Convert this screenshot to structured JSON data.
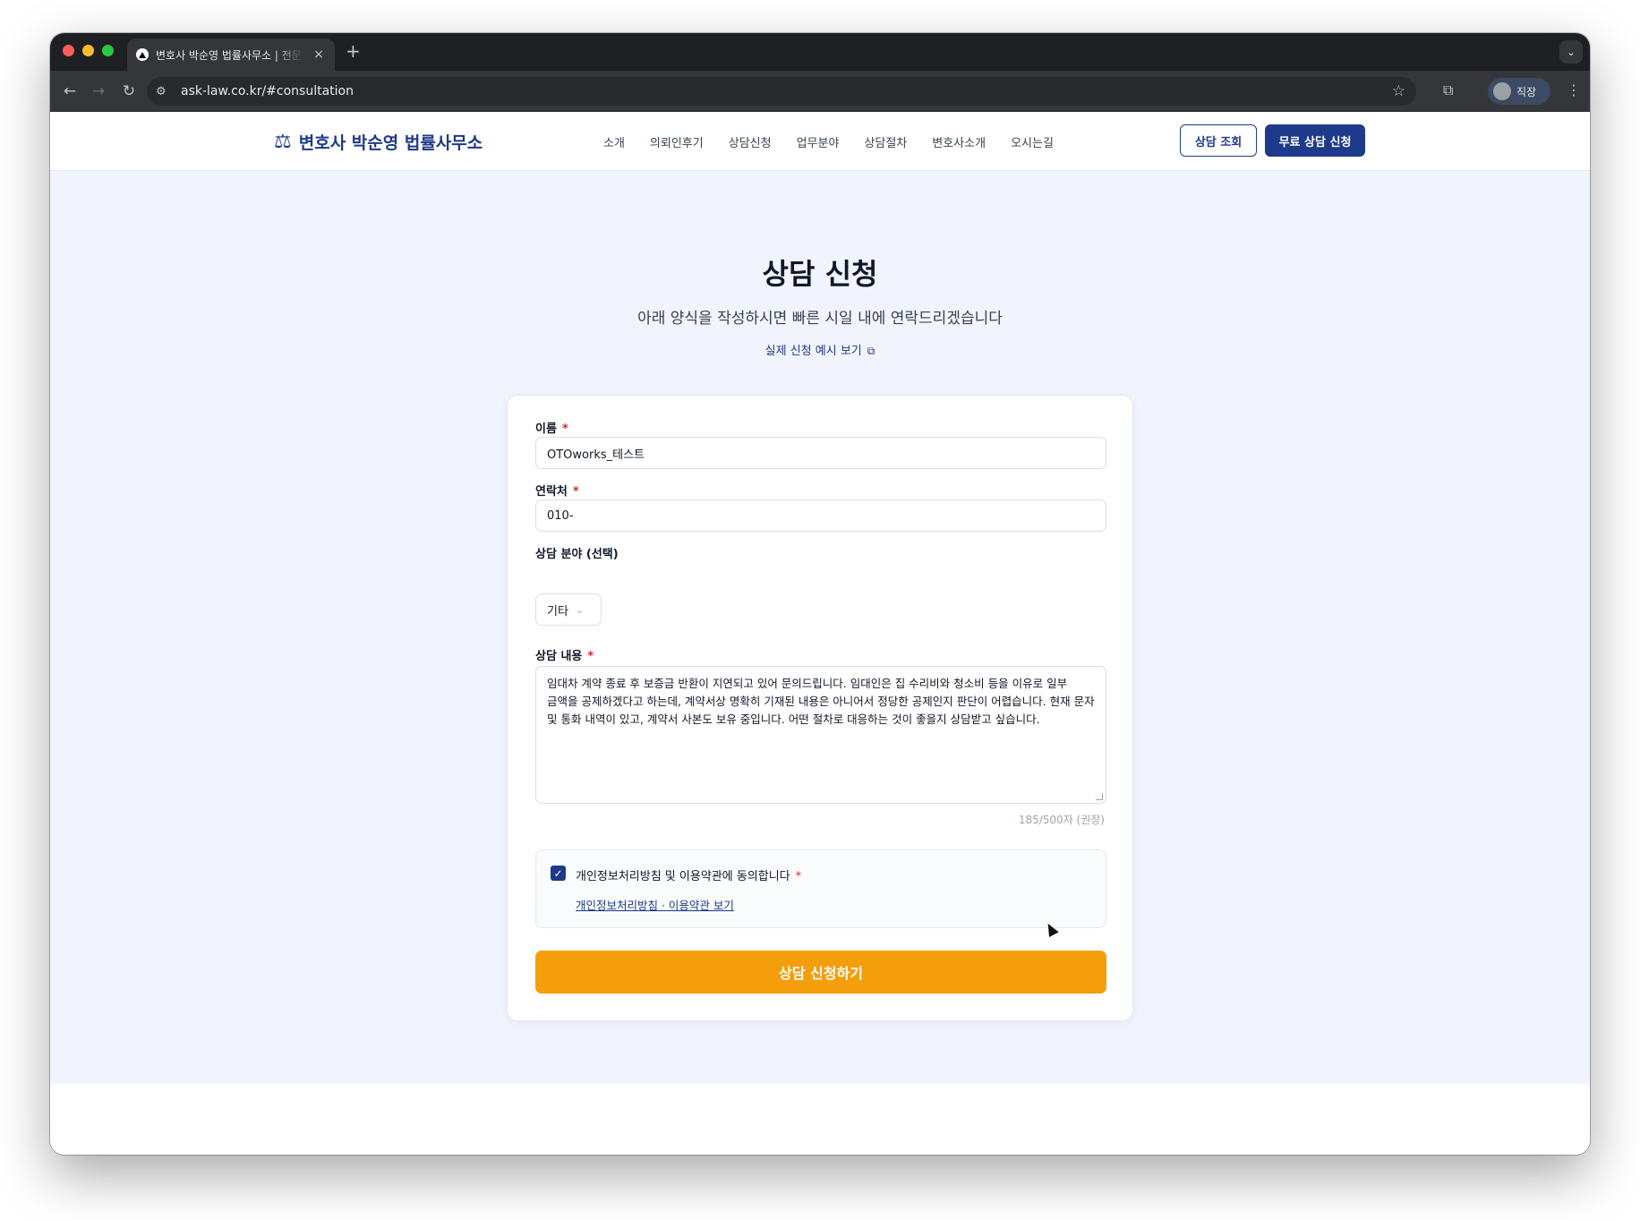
{
  "browser": {
    "tab_title": "변호사 박순영 법률사무소 | 전문 법률 상담",
    "tab_close": "×",
    "new_tab": "+",
    "tab_menu": "⌄",
    "back": "←",
    "forward": "→",
    "reload": "↻",
    "site_icon": "⚙",
    "url": "ask-law.co.kr/#consultation",
    "star": "☆",
    "extensions": "⧉",
    "profile_label": "직장",
    "menu": "⋮"
  },
  "header": {
    "logo_icon": "⚖",
    "logo_text": "변호사 박순영 법률사무소",
    "nav": [
      "소개",
      "의뢰인후기",
      "상담신청",
      "업무분야",
      "상담절차",
      "변호사소개",
      "오시는길"
    ],
    "check_button": "상담 조회",
    "apply_button": "무료 상담 신청"
  },
  "hero": {
    "title": "상담 신청",
    "subtitle": "아래 양식을 작성하시면 빠른 시일 내에 연락드리겠습니다",
    "example_link": "실제 신청 예시 보기",
    "example_icon": "⧉"
  },
  "form": {
    "name_label": "이름",
    "name_value": "OTOworks_테스트",
    "phone_label": "연락처",
    "phone_value": "010-",
    "category_label": "상담 분야 (선택)",
    "category_value": "기타",
    "category_chevron": "⌄",
    "content_label": "상담 내용",
    "content_value": "임대차 계약 종료 후 보증금 반환이 지연되고 있어 문의드립니다. 임대인은 집 수리비와 청소비 등을 이유로 일부 금액을 공제하겠다고 하는데, 계약서상 명확히 기재된 내용은 아니어서 정당한 공제인지 판단이 어렵습니다. 현재 문자 및 통화 내역이 있고, 계약서 사본도 보유 중입니다. 어떤 절차로 대응하는 것이 좋을지 상담받고 싶습니다.",
    "counter": "185/500자 (권장)",
    "required_mark": "*",
    "consent_check": "✓",
    "consent_text": "개인정보처리방침 및 이용약관에 동의합니다",
    "consent_link": "개인정보처리방침 · 이용약관 보기",
    "submit_label": "상담 신청하기"
  }
}
